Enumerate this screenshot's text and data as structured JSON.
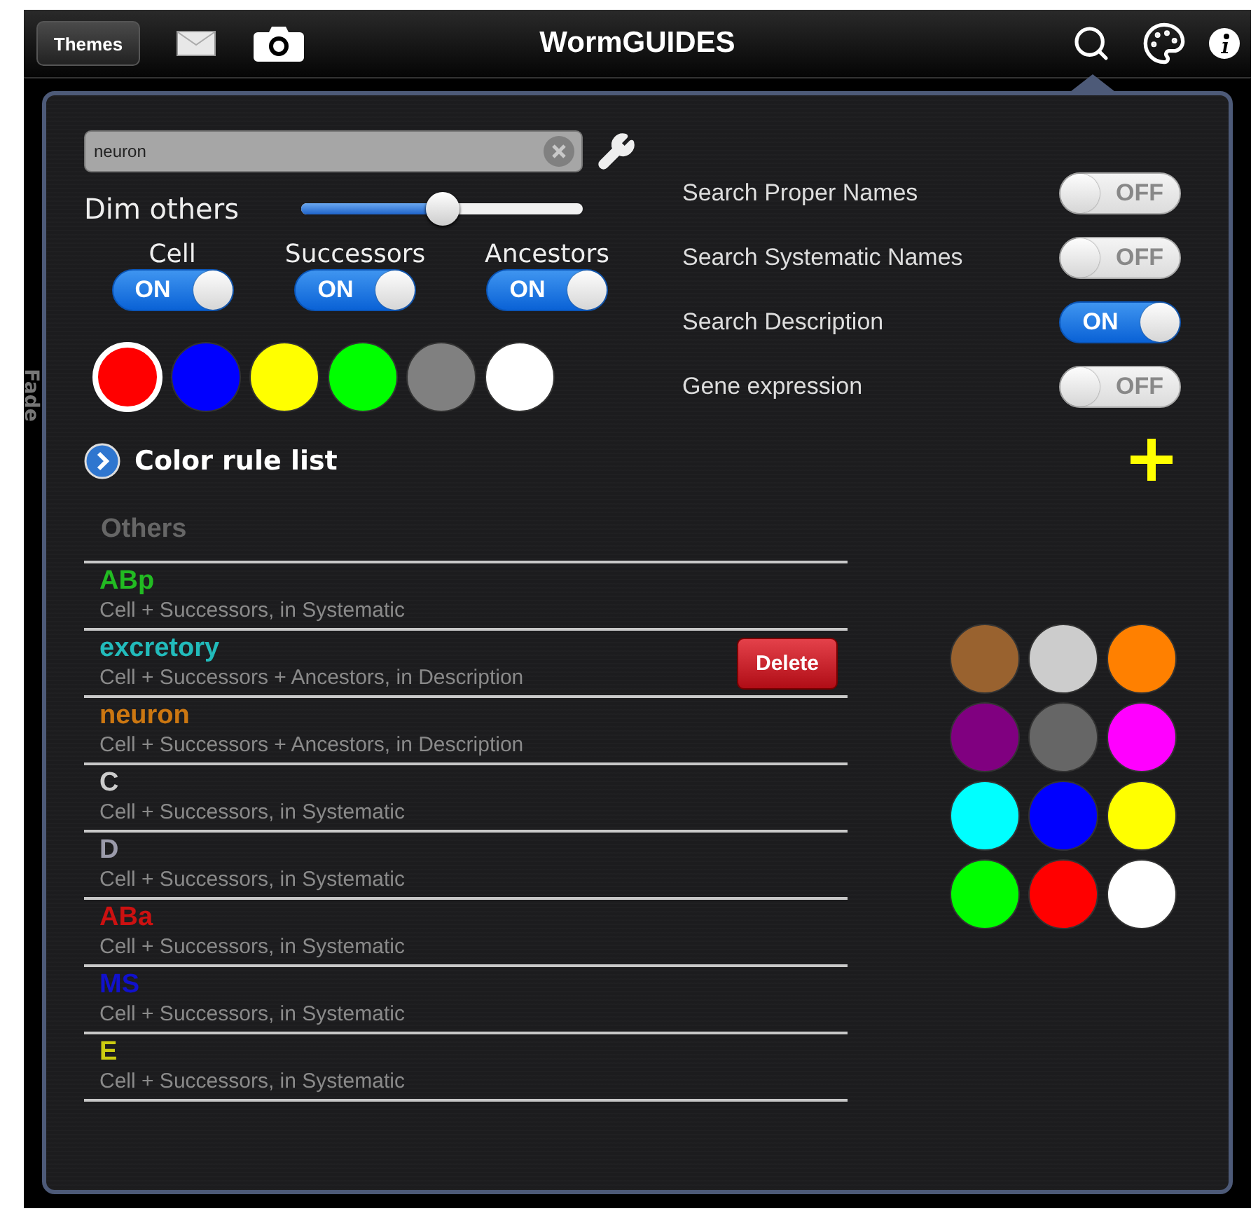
{
  "app": {
    "title": "WormGUIDES",
    "themes_button": "Themes"
  },
  "side_label": "Fade",
  "search": {
    "value": "neuron"
  },
  "dim": {
    "label": "Dim others",
    "level": 0.5
  },
  "scopes": [
    {
      "label": "Cell",
      "on": true,
      "state_text": "ON"
    },
    {
      "label": "Successors",
      "on": true,
      "state_text": "ON"
    },
    {
      "label": "Ancestors",
      "on": true,
      "state_text": "ON"
    }
  ],
  "palette": [
    {
      "color": "#ff0000",
      "selected": true
    },
    {
      "color": "#0000ff",
      "selected": false
    },
    {
      "color": "#ffff00",
      "selected": false
    },
    {
      "color": "#00ff00",
      "selected": false
    },
    {
      "color": "#808080",
      "selected": false
    },
    {
      "color": "#ffffff",
      "selected": false
    }
  ],
  "color_rule_link": "Color rule list",
  "options": [
    {
      "label": "Search Proper Names",
      "on": false,
      "state_text": "OFF"
    },
    {
      "label": "Search Systematic Names",
      "on": false,
      "state_text": "OFF"
    },
    {
      "label": "Search Description",
      "on": true,
      "state_text": "ON"
    },
    {
      "label": "Gene expression",
      "on": false,
      "state_text": "OFF"
    }
  ],
  "rules_header": "Others",
  "rules": [
    {
      "name": "ABp",
      "color": "#22bb22",
      "description": "Cell + Successors, in Systematic"
    },
    {
      "name": "excretory",
      "color": "#22bbbb",
      "description": "Cell + Successors + Ancestors, in Description",
      "delete_button": "Delete"
    },
    {
      "name": "neuron",
      "color": "#cc7711",
      "description": "Cell + Successors + Ancestors, in Description"
    },
    {
      "name": "C",
      "color": "#cccccc",
      "description": "Cell + Successors, in Systematic"
    },
    {
      "name": "D",
      "color": "#9a9aaa",
      "description": "Cell + Successors, in Systematic"
    },
    {
      "name": "ABa",
      "color": "#cc1111",
      "description": "Cell + Successors, in Systematic"
    },
    {
      "name": "MS",
      "color": "#1111cc",
      "description": "Cell + Successors, in Systematic"
    },
    {
      "name": "E",
      "color": "#cccc11",
      "description": "Cell + Successors, in Systematic"
    }
  ],
  "color_grid": [
    {
      "color": "#99622f"
    },
    {
      "color": "#cccccc"
    },
    {
      "color": "#ff8000"
    },
    {
      "color": "#800080"
    },
    {
      "color": "#666666"
    },
    {
      "color": "#ff00ff"
    },
    {
      "color": "#00ffff"
    },
    {
      "color": "#0000ff"
    },
    {
      "color": "#ffff00"
    },
    {
      "color": "#00ff00"
    },
    {
      "color": "#ff0000"
    },
    {
      "color": "#ffffff"
    }
  ]
}
